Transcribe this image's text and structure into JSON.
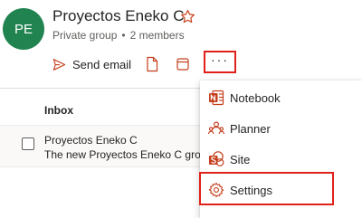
{
  "group": {
    "initials": "PE",
    "name": "Proyectos Eneko C",
    "privacy": "Private group",
    "separator": "•",
    "members": "2 members"
  },
  "toolbar": {
    "send_email_label": "Send email",
    "more_label": "···"
  },
  "inbox": {
    "header": "Inbox",
    "rows": [
      {
        "sender": "Proyectos Eneko C",
        "subject": "The new Proyectos Eneko C group is r"
      }
    ]
  },
  "menu": {
    "items": [
      {
        "label": "Notebook",
        "icon": "onenote-icon"
      },
      {
        "label": "Planner",
        "icon": "planner-icon"
      },
      {
        "label": "Site",
        "icon": "sharepoint-icon"
      },
      {
        "label": "Settings",
        "icon": "gear-icon"
      }
    ]
  },
  "colors": {
    "avatar_bg": "#218450",
    "accent": "#c43e1c",
    "highlight_border": "#e0211b",
    "text": "#252423",
    "subtext": "#605e5c"
  }
}
